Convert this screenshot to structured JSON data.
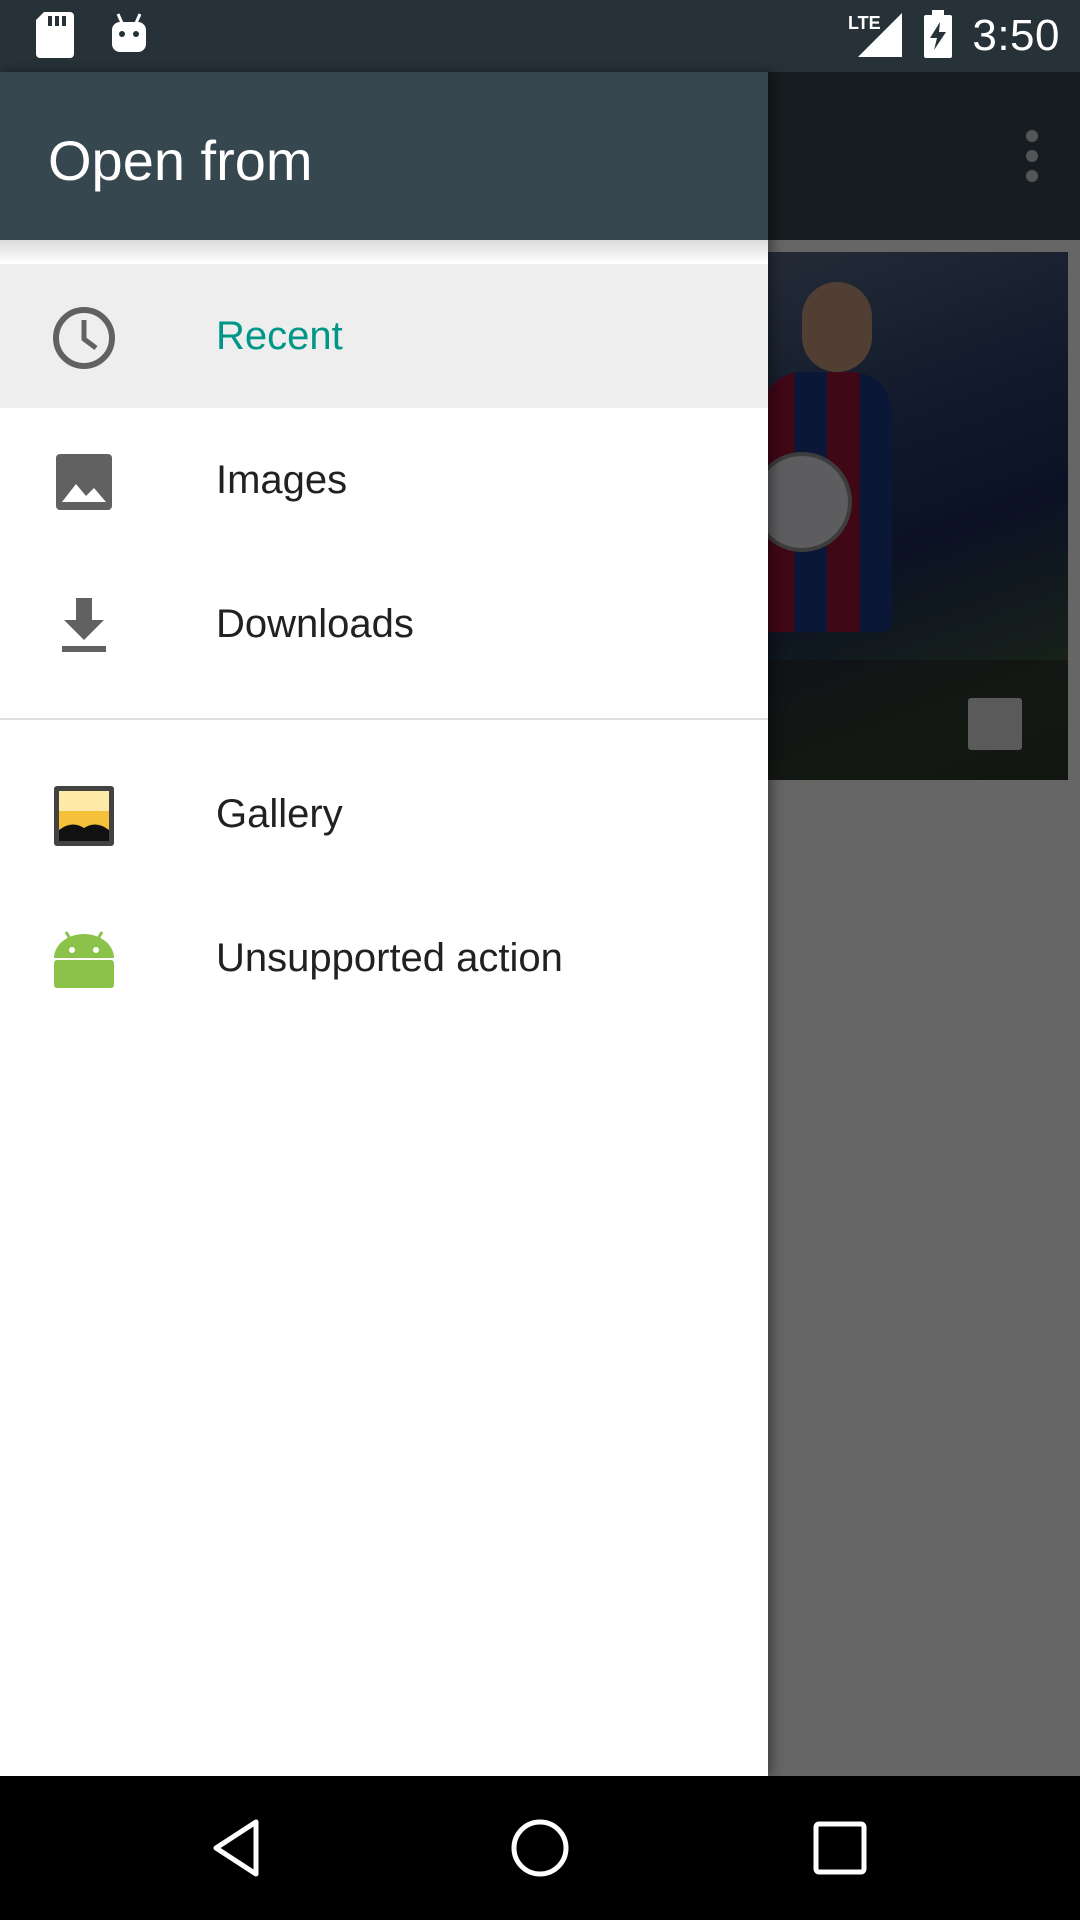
{
  "status_bar": {
    "time": "3:50",
    "network": "LTE",
    "icons": [
      "sd-card-icon",
      "android-notification-icon",
      "lte-signal-icon",
      "battery-charging-icon"
    ]
  },
  "background_app": {
    "overflow_icon": "more-vert-icon",
    "thumbnail_icon": "image-icon"
  },
  "drawer": {
    "title": "Open from",
    "items": [
      {
        "label": "Recent",
        "icon": "clock-icon",
        "selected": true
      },
      {
        "label": "Images",
        "icon": "image-icon",
        "selected": false
      },
      {
        "label": "Downloads",
        "icon": "download-icon",
        "selected": false
      }
    ],
    "apps": [
      {
        "label": "Gallery",
        "icon": "gallery-app-icon"
      },
      {
        "label": "Unsupported action",
        "icon": "android-app-icon"
      }
    ],
    "accent_color": "#009688",
    "header_color": "#37474f"
  },
  "nav_bar": {
    "buttons": [
      "back-icon",
      "home-icon",
      "recents-icon"
    ]
  }
}
